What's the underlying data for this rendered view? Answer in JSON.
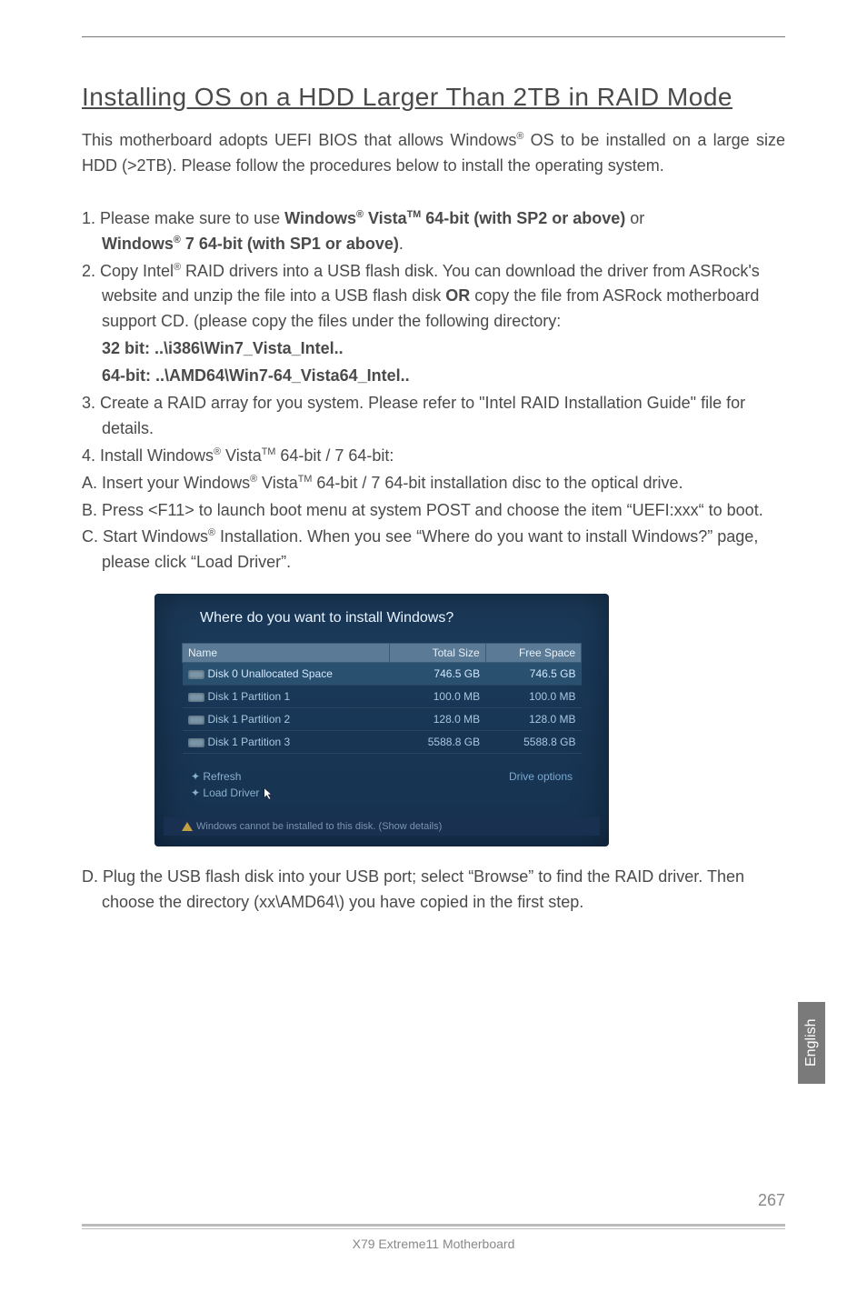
{
  "heading": "Installing OS on a HDD Larger Than 2TB in RAID Mode",
  "intro_parts": {
    "a": "This motherboard adopts UEFI BIOS that allows Windows",
    "b": " OS to be installed on a large size HDD (>2TB). Please follow the procedures below to install the operating system."
  },
  "steps": {
    "s1a": "1. Please make sure to use ",
    "s1b": "Windows",
    "s1c": " Vista",
    "s1d": " 64-bit (with SP2 or above)",
    "s1e": " or",
    "s1f": "Windows",
    "s1g": " 7 64-bit (with SP1 or above)",
    "s1h": ".",
    "s2a": "2. Copy Intel",
    "s2b": " RAID drivers into a USB flash disk. You can download the driver from ASRock's website and unzip the file into a USB flash disk ",
    "s2c": "OR",
    "s2d": " copy the file from ASRock motherboard support CD. (please copy the files under the following directory:",
    "s2e": "32 bit: ..\\i386\\Win7_Vista_Intel..",
    "s2f": "64-bit: ..\\AMD64\\Win7-64_Vista64_Intel..",
    "s3": "3. Create a RAID array for you system. Please refer to \"Intel RAID Installation Guide\" file for details.",
    "s4a": "4. Install Windows",
    "s4b": " Vista",
    "s4c": " 64-bit / 7 64-bit:",
    "s4Aa": "A. Insert your Windows",
    "s4Ab": " Vista",
    "s4Ac": " 64-bit / 7 64-bit installation disc to the optical drive.",
    "s4B": "B. Press <F11> to launch boot menu at system POST and choose the item “UEFI:xxx“ to boot.",
    "s4Ca": "C. Start Windows",
    "s4Cb": " Installation. When you see “Where do you want to install Windows?” page, please click “Load Driver”.",
    "s4D": "D. Plug the USB flash disk into your USB port; select “Browse” to find the RAID driver. Then choose the directory (xx\\AMD64\\) you have copied in the first step."
  },
  "screenshot": {
    "title": "Where do you want to install Windows?",
    "headers": {
      "name": "Name",
      "size": "Total Size",
      "free": "Free Space"
    },
    "rows": [
      {
        "name": "Disk 0 Unallocated Space",
        "size": "746.5 GB",
        "free": "746.5 GB",
        "selected": true
      },
      {
        "name": "Disk 1 Partition 1",
        "size": "100.0 MB",
        "free": "100.0 MB",
        "selected": false
      },
      {
        "name": "Disk 1 Partition 2",
        "size": "128.0 MB",
        "free": "128.0 MB",
        "selected": false
      },
      {
        "name": "Disk 1 Partition 3",
        "size": "5588.8 GB",
        "free": "5588.8 GB",
        "selected": false
      }
    ],
    "refresh": "Refresh",
    "load_driver": "Load Driver",
    "drive_options": "Drive options",
    "warning": "Windows cannot be installed to this disk. (Show details)"
  },
  "side_tab": "English",
  "footer_product": "X79  Extreme11  Motherboard",
  "page_number": "267"
}
